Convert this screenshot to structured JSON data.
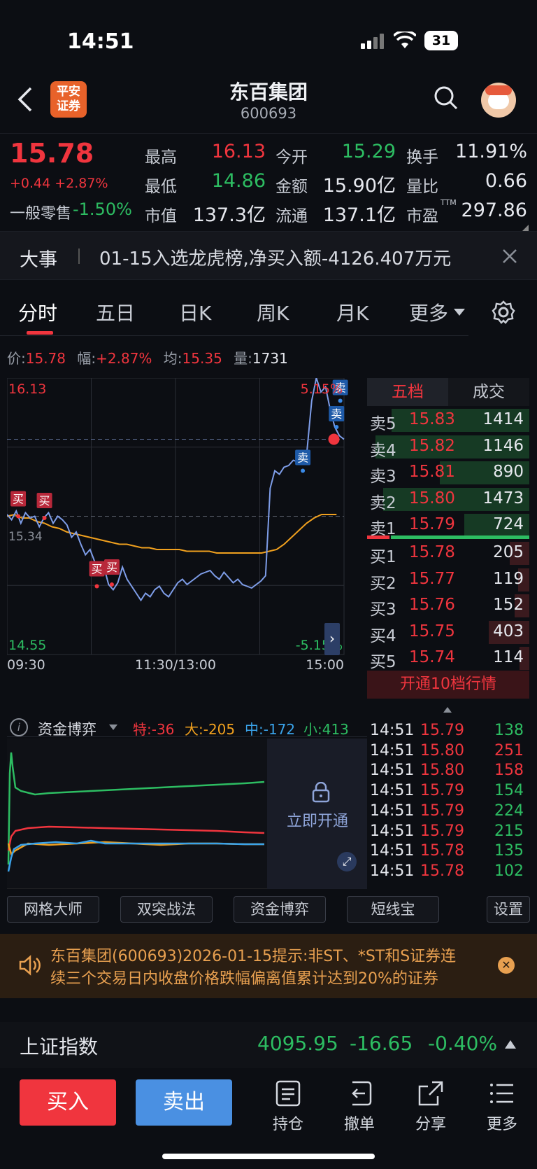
{
  "status_bar": {
    "time": "14:51",
    "battery": "31"
  },
  "header": {
    "title": "东百集团",
    "code": "600693",
    "logo_text": "平安证券"
  },
  "quote": {
    "price": "15.78",
    "change": "+0.44 +2.87%",
    "sector_label": "一般零售",
    "sector_change": "-1.50%",
    "labels": {
      "high": "最高",
      "low": "最低",
      "mcap": "市值",
      "open": "今开",
      "amount": "金额",
      "float": "流通",
      "turnover": "换手",
      "vol_ratio": "量比",
      "pe": "市盈",
      "pe_sup": "TTM"
    },
    "values": {
      "high": "16.13",
      "low": "14.86",
      "mcap": "137.3亿",
      "open": "15.29",
      "amount": "15.90亿",
      "float": "137.1亿",
      "turnover": "11.91%",
      "vol_ratio": "0.66",
      "pe": "297.86"
    }
  },
  "news": {
    "tag": "大事",
    "text": "01-15入选龙虎榜,净买入额-4126.407万元"
  },
  "tabs": [
    "分时",
    "五日",
    "日K",
    "周K",
    "月K",
    "更多"
  ],
  "info_bar": {
    "price_label": "价:",
    "price": "15.78",
    "range_label": "幅:",
    "range": "+2.87%",
    "avg_label": "均:",
    "avg": "15.35",
    "vol_label": "量:",
    "vol": "1731"
  },
  "chart_data": {
    "type": "line",
    "ylim": [
      14.55,
      16.13
    ],
    "y_top_label": "16.13",
    "y_bottom_label": "14.55",
    "pct_top_label": "5.15%",
    "pct_bottom_label": "-5.15%",
    "ref_label": "15.34",
    "x_labels": [
      "09:30",
      "11:30/13:00",
      "15:00"
    ],
    "series": [
      {
        "values": [
          15.35,
          15.32,
          15.37,
          15.3,
          15.36,
          15.33,
          15.34,
          15.28,
          15.33,
          15.36,
          15.3,
          15.34,
          15.32,
          15.29,
          15.22,
          15.25,
          15.18,
          15.12,
          15.15,
          15.08,
          15.02,
          15.05,
          14.95,
          14.92,
          14.96,
          15.05,
          14.98,
          14.94,
          14.9,
          14.86,
          14.9,
          14.88,
          14.92,
          14.94,
          14.9,
          14.88,
          14.92,
          14.96,
          14.98,
          14.95,
          14.97,
          14.99,
          15.01,
          15.02,
          15.03,
          15.0,
          14.98,
          15.02,
          14.99,
          14.96,
          14.98,
          14.95,
          14.94,
          14.93,
          14.95,
          14.97,
          15.0,
          15.5,
          15.6,
          15.58,
          15.62,
          15.63,
          15.66,
          15.65,
          15.68,
          15.72,
          16.0,
          16.13,
          16.05,
          16.08,
          15.95,
          15.85,
          15.8,
          15.78
        ]
      },
      {
        "values": [
          15.34,
          15.35,
          15.33,
          15.33,
          15.31,
          15.3,
          15.28,
          15.27,
          15.25,
          15.24,
          15.23,
          15.22,
          15.21,
          15.2,
          15.19,
          15.18,
          15.18,
          15.17,
          15.16,
          15.16,
          15.15,
          15.15,
          15.15,
          15.15,
          15.14,
          15.14,
          15.14,
          15.14,
          15.13,
          15.13,
          15.13,
          15.13,
          15.13,
          15.13,
          15.13,
          15.14,
          15.15,
          15.18,
          15.22,
          15.26,
          15.3,
          15.33,
          15.35,
          15.35,
          15.35
        ]
      }
    ],
    "markers": [
      {
        "label": "买",
        "x": 3,
        "y": 15.34
      },
      {
        "label": "买",
        "x": 10,
        "y": 15.33
      },
      {
        "label": "买",
        "x": 24,
        "y": 14.94
      },
      {
        "label": "买",
        "x": 28,
        "y": 14.95
      },
      {
        "label": "卖",
        "x": 79,
        "y": 15.6
      },
      {
        "label": "卖",
        "x": 88,
        "y": 15.85
      },
      {
        "label": "卖",
        "x": 89,
        "y": 16.0
      }
    ]
  },
  "order_book": {
    "tab_active": "五档",
    "tab_other": "成交",
    "asks": [
      {
        "label": "卖5",
        "price": "15.83",
        "vol": "1414",
        "fill": 0.85
      },
      {
        "label": "卖4",
        "price": "15.82",
        "vol": "1146",
        "fill": 0.95
      },
      {
        "label": "卖3",
        "price": "15.81",
        "vol": "890",
        "fill": 0.55
      },
      {
        "label": "卖2",
        "price": "15.80",
        "vol": "1473",
        "fill": 0.9
      },
      {
        "label": "卖1",
        "price": "15.79",
        "vol": "724",
        "fill": 0.4
      }
    ],
    "bids": [
      {
        "label": "买1",
        "price": "15.78",
        "vol": "205",
        "fill": 0.12
      },
      {
        "label": "买2",
        "price": "15.77",
        "vol": "119",
        "fill": 0.07
      },
      {
        "label": "买3",
        "price": "15.76",
        "vol": "152",
        "fill": 0.09
      },
      {
        "label": "买4",
        "price": "15.75",
        "vol": "403",
        "fill": 0.25
      },
      {
        "label": "买5",
        "price": "15.74",
        "vol": "114",
        "fill": 0.06
      }
    ],
    "open_10_label": "开通10档行情"
  },
  "trades": [
    {
      "time": "14:51",
      "price": "15.79",
      "vol": "138",
      "dir": "green"
    },
    {
      "time": "14:51",
      "price": "15.80",
      "vol": "251",
      "dir": "red"
    },
    {
      "time": "14:51",
      "price": "15.80",
      "vol": "158",
      "dir": "red"
    },
    {
      "time": "14:51",
      "price": "15.79",
      "vol": "154",
      "dir": "green"
    },
    {
      "time": "14:51",
      "price": "15.79",
      "vol": "224",
      "dir": "green"
    },
    {
      "time": "14:51",
      "price": "15.79",
      "vol": "215",
      "dir": "green"
    },
    {
      "time": "14:51",
      "price": "15.78",
      "vol": "135",
      "dir": "green"
    },
    {
      "time": "14:51",
      "price": "15.78",
      "vol": "102",
      "dir": "green"
    }
  ],
  "flow": {
    "title": "资金博弈",
    "te": "特:-36",
    "da": "大:-205",
    "zhong": "中:-172",
    "xiao": "小:413",
    "unlock": "立即开通"
  },
  "toolbar": [
    "网格大师",
    "双突战法",
    "资金博弈",
    "短线宝",
    "设置"
  ],
  "alert": {
    "text_line1": "东百集团(600693)2026-01-15提示:非ST、*ST和S证券连",
    "text_line2": "续三个交易日内收盘价格跌幅偏离值累计达到20%的证券"
  },
  "index_bar": {
    "name": "上证指数",
    "value": "4095.95",
    "change": "-16.65",
    "pct": "-0.40%"
  },
  "bottom": {
    "buy": "买入",
    "sell": "卖出",
    "hold": "持仓",
    "cancel": "撤单",
    "share": "分享",
    "more": "更多"
  },
  "colors": {
    "up": "#f0353e",
    "down": "#2dbd62",
    "accent_blue": "#4a90e2",
    "avg_line": "#f0a01e",
    "price_line": "#7e9de8"
  }
}
